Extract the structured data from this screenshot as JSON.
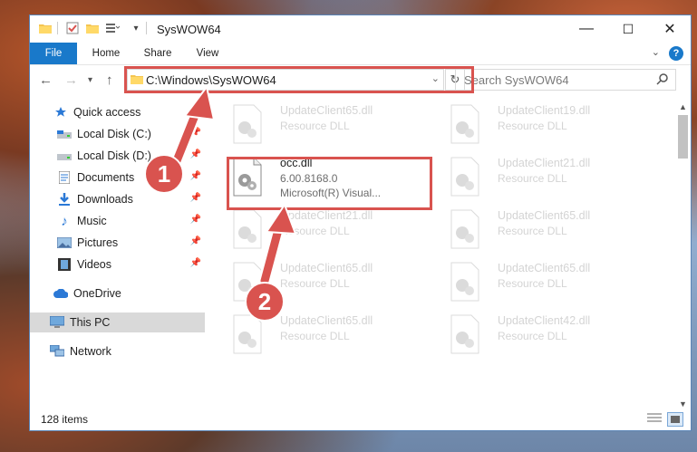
{
  "window": {
    "title": "SysWOW64",
    "controls": {
      "minimize": "—",
      "maximize": "☐",
      "close": "✕"
    }
  },
  "ribbon": {
    "tabs": [
      "File",
      "Home",
      "Share",
      "View"
    ],
    "help": "?"
  },
  "address": {
    "path": "C:\\Windows\\SysWOW64",
    "search_placeholder": "Search SysWOW64"
  },
  "sidebar": {
    "items": [
      {
        "label": "Quick access",
        "icon": "star-icon"
      },
      {
        "label": "Local Disk (C:)",
        "icon": "drive-icon",
        "pinned": true
      },
      {
        "label": "Local Disk (D:)",
        "icon": "drive-icon",
        "pinned": true
      },
      {
        "label": "Documents",
        "icon": "documents-icon",
        "pinned": true
      },
      {
        "label": "Downloads",
        "icon": "download-icon",
        "pinned": true
      },
      {
        "label": "Music",
        "icon": "music-icon",
        "pinned": true
      },
      {
        "label": "Pictures",
        "icon": "pictures-icon",
        "pinned": true
      },
      {
        "label": "Videos",
        "icon": "videos-icon",
        "pinned": true
      },
      {
        "label": "OneDrive",
        "icon": "cloud-icon"
      },
      {
        "label": "This PC",
        "icon": "computer-icon",
        "selected": true
      },
      {
        "label": "Network",
        "icon": "network-icon"
      }
    ]
  },
  "files": [
    {
      "name": "UpdateClient65.dll",
      "sub1": "Resource DLL"
    },
    {
      "name": "UpdateClient19.dll",
      "sub1": "Resource DLL"
    },
    {
      "name": "occ.dll",
      "sub1": "6.00.8168.0",
      "sub2": "Microsoft(R) Visual...",
      "highlight": true
    },
    {
      "name": "UpdateClient21.dll",
      "sub1": "Resource DLL"
    },
    {
      "name": "UpdateClient21.dll",
      "sub1": "Resource DLL"
    },
    {
      "name": "UpdateClient65.dll",
      "sub1": "Resource DLL"
    },
    {
      "name": "UpdateClient65.dll",
      "sub1": "Resource DLL"
    },
    {
      "name": "UpdateClient65.dll",
      "sub1": "Resource DLL"
    },
    {
      "name": "UpdateClient65.dll",
      "sub1": "Resource DLL"
    },
    {
      "name": "UpdateClient42.dll",
      "sub1": "Resource DLL"
    }
  ],
  "status": {
    "count": "128 items"
  },
  "annotations": {
    "step1": "1",
    "step2": "2",
    "color": "#d9534f"
  }
}
